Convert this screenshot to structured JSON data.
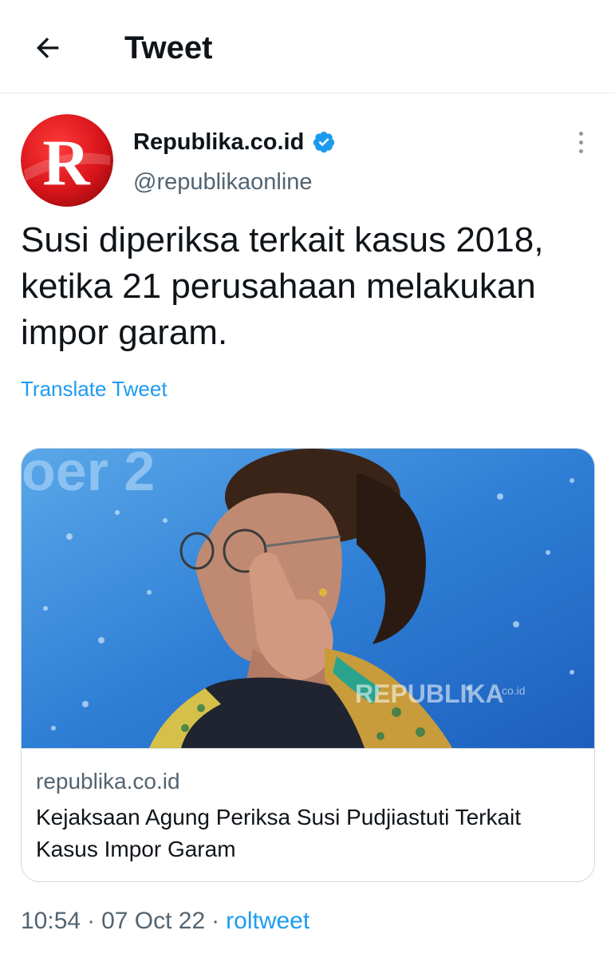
{
  "header": {
    "title": "Tweet",
    "back_icon": "arrow-left-icon"
  },
  "tweet": {
    "author": {
      "name": "Republika.co.id",
      "handle": "@republikaonline",
      "verified": true,
      "avatar_letter": "R",
      "avatar_color": "#d7141a"
    },
    "text": "Susi diperiksa terkait kasus 2018, ketika 21 perusahaan melakukan impor garam.",
    "translate_label": "Translate Tweet",
    "card": {
      "domain": "republika.co.id",
      "title": "Kejaksaan Agung Periksa Susi Pudjiastuti Terkait Kasus Impor Garam",
      "image_watermark": "REPUBLIKA",
      "image_watermark_suffix": "co.id"
    },
    "time": "10:54",
    "date": "07 Oct 22",
    "source": "roltweet",
    "separator": "·"
  },
  "colors": {
    "accent": "#1d9bf0",
    "secondary_text": "#536471",
    "border": "#cfd9de"
  }
}
